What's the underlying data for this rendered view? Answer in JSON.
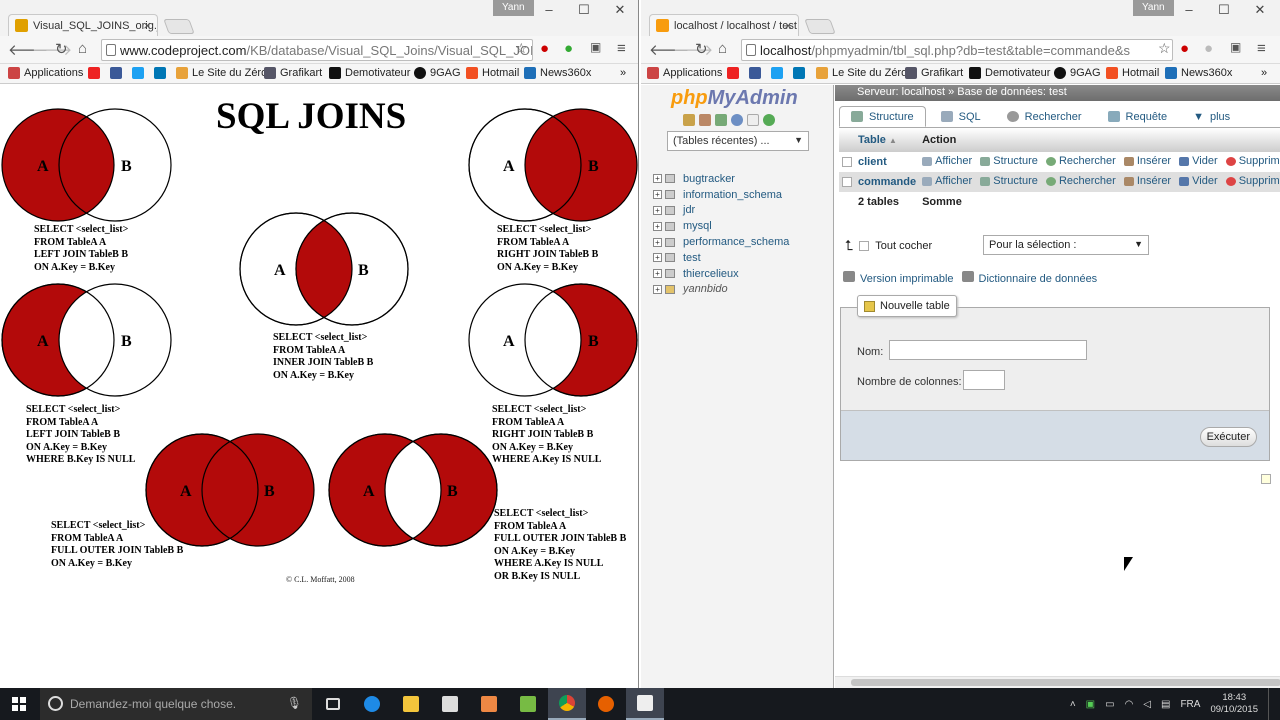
{
  "left_window": {
    "tab_title": "Visual_SQL_JOINS_orig.jpg",
    "user": "Yann",
    "url_host": "www.codeproject.com",
    "url_path": "/KB/database/Visual_SQL_Joins/Visual_SQL_JOI",
    "image": {
      "title": "SQL JOINS",
      "circle_a": "A",
      "circle_b": "B",
      "fill_color": "#b30a0a",
      "queries": {
        "left_join": "SELECT <select_list>\nFROM TableA A\nLEFT JOIN TableB B\nON A.Key = B.Key",
        "right_join": "SELECT <select_list>\nFROM TableA A\nRIGHT JOIN TableB B\nON A.Key = B.Key",
        "inner_join": "SELECT <select_list>\nFROM TableA A\nINNER JOIN TableB B\nON A.Key = B.Key",
        "left_excl": "SELECT <select_list>\nFROM TableA A\nLEFT JOIN TableB B\nON A.Key = B.Key\nWHERE B.Key IS NULL",
        "right_excl": "SELECT <select_list>\nFROM TableA A\nRIGHT JOIN TableB B\nON A.Key = B.Key\nWHERE A.Key IS NULL",
        "full_outer": "SELECT <select_list>\nFROM TableA A\nFULL OUTER JOIN TableB B\nON A.Key = B.Key",
        "full_outer_excl": "SELECT <select_list>\nFROM TableA A\nFULL OUTER JOIN TableB B\nON A.Key = B.Key\nWHERE A.Key IS NULL\nOR B.Key IS NULL"
      },
      "copyright": "© C.L. Moffatt, 2008"
    }
  },
  "right_window": {
    "tab_title": "localhost / localhost / test",
    "user": "Yann",
    "url_host": "localhost",
    "url_path": "/phpmyadmin/tbl_sql.php?db=test&table=commande&s",
    "pma": {
      "logo_php": "php",
      "logo_myadmin": "MyAdmin",
      "recent_tables": "(Tables récentes) ...",
      "databases": [
        "bugtracker",
        "information_schema",
        "jdr",
        "mysql",
        "performance_schema",
        "test",
        "thiercelieux",
        "yannbido"
      ],
      "breadcrumb_server": "Serveur: localhost",
      "breadcrumb_sep": "»",
      "breadcrumb_db": "Base de données: test",
      "tabs": [
        "Structure",
        "SQL",
        "Rechercher",
        "Requête",
        "plus"
      ],
      "table_header": {
        "table": "Table",
        "sort": "▲",
        "action": "Action"
      },
      "tables": [
        {
          "name": "client",
          "actions": [
            "Afficher",
            "Structure",
            "Rechercher",
            "Insérer",
            "Vider",
            "Supprimer"
          ]
        },
        {
          "name": "commande",
          "actions": [
            "Afficher",
            "Structure",
            "Rechercher",
            "Insérer",
            "Vider",
            "Supprimer"
          ]
        }
      ],
      "footer_count": "2 tables",
      "footer_sum": "Somme",
      "check_all": "Tout cocher",
      "with_selected": "Pour la sélection :",
      "print_view": "Version imprimable",
      "data_dictionary": "Dictionnaire de données",
      "new_table": "Nouvelle table",
      "name_label": "Nom:",
      "columns_label": "Nombre de colonnes:",
      "execute": "Exécuter"
    }
  },
  "bookmarks": [
    "Applications",
    "",
    "",
    "",
    "",
    "Le Site du Zéro",
    "Grafikart",
    "Demotivateur",
    "9GAG",
    "Hotmail",
    "News360x"
  ],
  "taskbar": {
    "search_placeholder": "Demandez-moi quelque chose.",
    "language": "FRA",
    "time": "18:43",
    "date": "09/10/2015"
  }
}
